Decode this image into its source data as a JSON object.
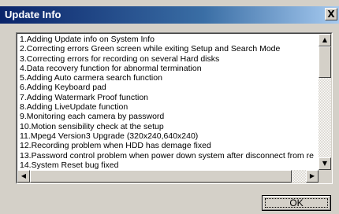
{
  "window": {
    "title": "Update Info",
    "close_glyph": "X"
  },
  "list": {
    "lines": [
      "1.Adding Update info on System Info",
      "2.Correcting  errors Green screen while exiting Setup and Search Mode",
      "3.Correcting errors for recording on several Hard disks",
      "4.Data recovery function for abnormal termination",
      "5.Adding Auto carmera search function",
      "6.Adding Keyboard pad",
      "7.Adding Watermark Proof function",
      "8.Adding LiveUpdate function",
      "9.Monitoring each camera by password",
      "10.Motion sensibility check at the setup",
      "11.Mpeg4 Version3 Upgrade (320x240,640x240)",
      "12.Recording problem when HDD has demage fixed",
      "13.Password control problem when power down system after disconnect from re",
      "14.System Reset bug fixed"
    ]
  },
  "scrollbar": {
    "up_glyph": "▲",
    "down_glyph": "▼",
    "left_glyph": "◀",
    "right_glyph": "▶"
  },
  "buttons": {
    "ok_label": "OK"
  }
}
